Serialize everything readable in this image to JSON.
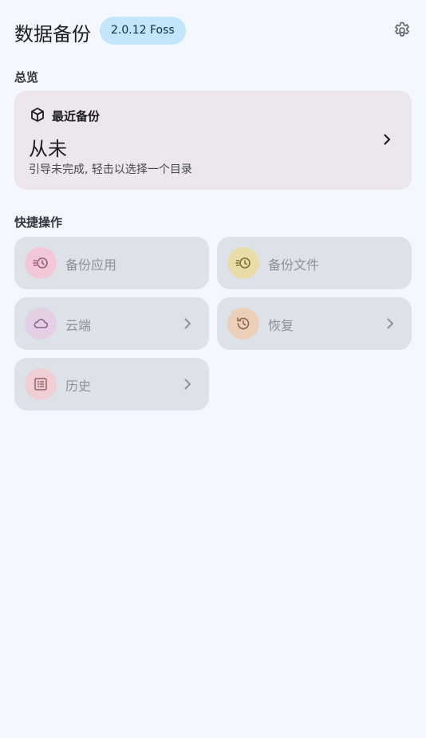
{
  "header": {
    "title": "数据备份",
    "version": "2.0.12 Foss",
    "settings_icon": "gear-icon"
  },
  "overview": {
    "section_title": "总览",
    "card_icon": "package-icon",
    "label": "最近备份",
    "value": "从未",
    "hint": "引导未完成, 轻击以选择一个目录"
  },
  "quick_actions": {
    "section_title": "快捷操作",
    "items": [
      {
        "label": "备份应用",
        "icon": "clock-rewind-icon",
        "color": "#f2c8d8"
      },
      {
        "label": "备份文件",
        "icon": "clock-rewind-icon",
        "color": "#e8dda9"
      },
      {
        "label": "云端",
        "icon": "cloud-icon",
        "color": "#e4cfe5"
      },
      {
        "label": "恢复",
        "icon": "history-icon",
        "color": "#eccfb8"
      },
      {
        "label": "历史",
        "icon": "list-icon",
        "color": "#efcfd3"
      }
    ]
  }
}
